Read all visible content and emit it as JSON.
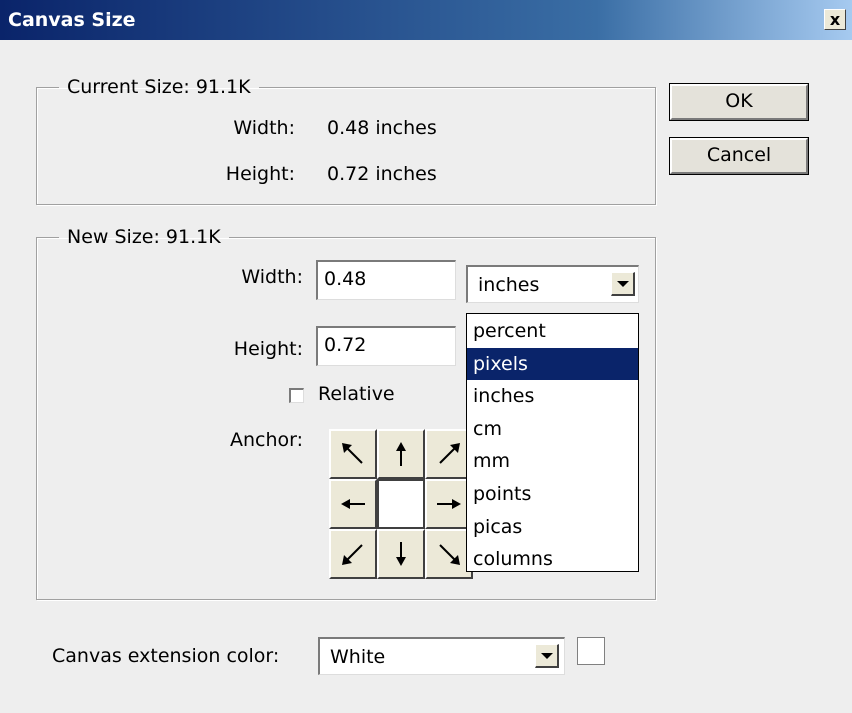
{
  "window": {
    "title": "Canvas Size",
    "close_label": "x"
  },
  "current_size": {
    "legend": "Current Size: 91.1K",
    "width_label": "Width:",
    "width_value": "0.48 inches",
    "height_label": "Height:",
    "height_value": "0.72 inches"
  },
  "new_size": {
    "legend": "New Size: 91.1K",
    "width_label": "Width:",
    "width_value": "0.48",
    "height_label": "Height:",
    "height_value": "0.72",
    "unit_selected": "inches",
    "relative_label": "Relative",
    "relative_checked": false,
    "anchor_label": "Anchor:"
  },
  "unit_options": [
    "percent",
    "pixels",
    "inches",
    "cm",
    "mm",
    "points",
    "picas",
    "columns"
  ],
  "unit_highlighted": "pixels",
  "buttons": {
    "ok": "OK",
    "cancel": "Cancel"
  },
  "extension": {
    "label": "Canvas extension color:",
    "value": "White",
    "swatch_color": "#FFFFFF"
  },
  "colors": {
    "title_bar": "#0A246A",
    "selection": "#0A246A"
  }
}
